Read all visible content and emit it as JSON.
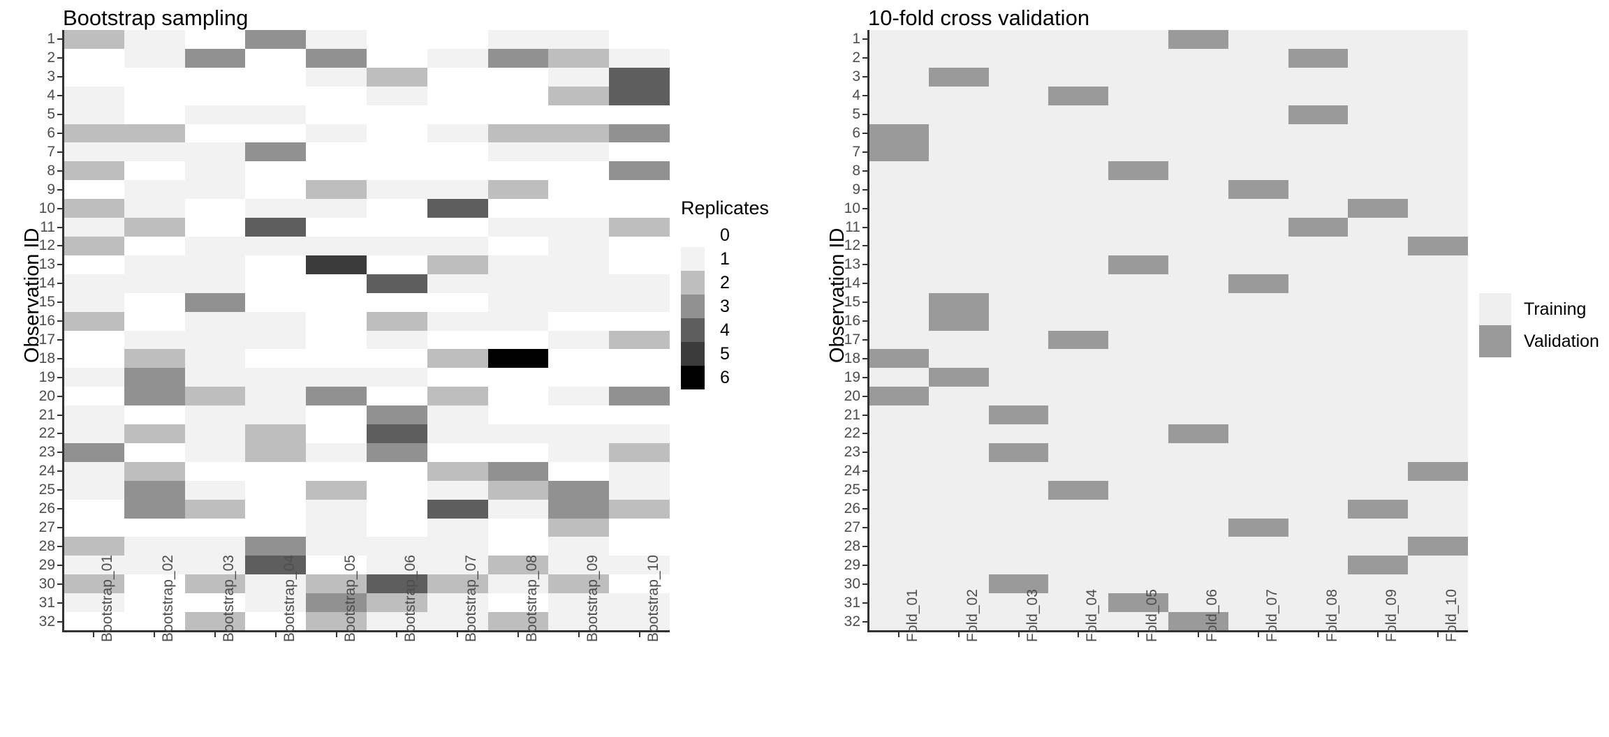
{
  "left_panel": {
    "title": "Bootstrap sampling",
    "y_axis_title": "Observation ID",
    "legend_title": "Replicates"
  },
  "right_panel": {
    "title": "10-fold cross validation",
    "y_axis_title": "Observation ID"
  },
  "legend_replicates": {
    "title": "Replicates",
    "entries": [
      {
        "label": "0",
        "color": "#FFFFFF"
      },
      {
        "label": "1",
        "color": "#F2F2F2"
      },
      {
        "label": "2",
        "color": "#BEBEBE"
      },
      {
        "label": "3",
        "color": "#919191"
      },
      {
        "label": "4",
        "color": "#5E5E5E"
      },
      {
        "label": "5",
        "color": "#3B3B3B"
      },
      {
        "label": "6",
        "color": "#000000"
      }
    ]
  },
  "legend_cv": {
    "entries": [
      {
        "label": "Training",
        "color": "#EFEFEF"
      },
      {
        "label": "Validation",
        "color": "#9A9A9A"
      }
    ]
  },
  "chart_data": [
    {
      "type": "heatmap",
      "title": "Bootstrap sampling",
      "xlabel": "",
      "ylabel": "Observation ID",
      "legend_title": "Replicates",
      "legend_position": "right",
      "grid": false,
      "value_range": [
        0,
        6
      ],
      "color_scale": [
        "#FFFFFF",
        "#F2F2F2",
        "#BEBEBE",
        "#919191",
        "#5E5E5E",
        "#3B3B3B",
        "#000000"
      ],
      "x": [
        "Bootstrap_01",
        "Bootstrap_02",
        "Bootstrap_03",
        "Bootstrap_04",
        "Bootstrap_05",
        "Bootstrap_06",
        "Bootstrap_07",
        "Bootstrap_08",
        "Bootstrap_09",
        "Bootstrap_10"
      ],
      "y": [
        "1",
        "2",
        "3",
        "4",
        "5",
        "6",
        "7",
        "8",
        "9",
        "10",
        "11",
        "12",
        "13",
        "14",
        "15",
        "16",
        "17",
        "18",
        "19",
        "20",
        "21",
        "22",
        "23",
        "24",
        "25",
        "26",
        "27",
        "28",
        "29",
        "30",
        "31",
        "32"
      ],
      "values": [
        [
          2,
          1,
          0,
          3,
          1,
          0,
          0,
          1,
          1,
          0
        ],
        [
          0,
          1,
          3,
          0,
          3,
          0,
          1,
          3,
          2,
          1
        ],
        [
          0,
          0,
          0,
          0,
          1,
          2,
          0,
          0,
          1,
          4
        ],
        [
          1,
          0,
          0,
          0,
          0,
          1,
          0,
          0,
          2,
          4
        ],
        [
          1,
          0,
          1,
          1,
          0,
          0,
          0,
          0,
          0,
          0
        ],
        [
          2,
          2,
          0,
          0,
          1,
          0,
          1,
          2,
          2,
          3
        ],
        [
          1,
          1,
          1,
          3,
          0,
          0,
          0,
          1,
          1,
          0
        ],
        [
          2,
          0,
          1,
          0,
          0,
          0,
          0,
          0,
          0,
          3
        ],
        [
          0,
          1,
          1,
          0,
          2,
          1,
          1,
          2,
          0,
          0
        ],
        [
          2,
          1,
          0,
          1,
          1,
          0,
          4,
          0,
          0,
          0
        ],
        [
          1,
          2,
          0,
          4,
          0,
          0,
          0,
          1,
          1,
          2
        ],
        [
          2,
          0,
          1,
          1,
          1,
          1,
          1,
          0,
          1,
          0
        ],
        [
          0,
          1,
          1,
          0,
          5,
          0,
          2,
          1,
          1,
          0
        ],
        [
          1,
          1,
          1,
          0,
          0,
          4,
          1,
          1,
          1,
          1
        ],
        [
          1,
          0,
          3,
          0,
          0,
          0,
          0,
          1,
          1,
          1
        ],
        [
          2,
          0,
          1,
          1,
          0,
          2,
          1,
          1,
          0,
          0
        ],
        [
          0,
          1,
          1,
          1,
          0,
          1,
          0,
          0,
          1,
          2
        ],
        [
          0,
          2,
          1,
          0,
          0,
          0,
          2,
          6,
          0,
          0
        ],
        [
          1,
          3,
          1,
          1,
          1,
          1,
          0,
          0,
          0,
          0
        ],
        [
          0,
          3,
          2,
          1,
          3,
          0,
          2,
          0,
          1,
          3
        ],
        [
          1,
          0,
          1,
          1,
          0,
          3,
          1,
          0,
          0,
          0
        ],
        [
          1,
          2,
          1,
          2,
          0,
          4,
          1,
          1,
          1,
          1
        ],
        [
          3,
          0,
          1,
          2,
          1,
          3,
          0,
          0,
          1,
          2
        ],
        [
          1,
          2,
          0,
          0,
          0,
          0,
          2,
          3,
          0,
          1
        ],
        [
          1,
          3,
          1,
          0,
          2,
          0,
          1,
          2,
          3,
          1
        ],
        [
          0,
          3,
          2,
          0,
          1,
          0,
          4,
          1,
          3,
          2
        ],
        [
          0,
          0,
          0,
          0,
          1,
          0,
          1,
          0,
          2,
          0
        ],
        [
          2,
          1,
          1,
          3,
          1,
          1,
          1,
          0,
          1,
          0
        ],
        [
          1,
          1,
          1,
          4,
          0,
          1,
          1,
          2,
          1,
          1
        ],
        [
          2,
          0,
          2,
          1,
          2,
          4,
          2,
          1,
          2,
          0
        ],
        [
          1,
          0,
          0,
          1,
          3,
          2,
          1,
          0,
          1,
          1
        ],
        [
          0,
          0,
          2,
          0,
          2,
          1,
          1,
          2,
          1,
          1
        ]
      ]
    },
    {
      "type": "heatmap",
      "title": "10-fold cross validation",
      "xlabel": "",
      "ylabel": "Observation ID",
      "legend_position": "right",
      "grid": false,
      "categories_legend": [
        "Training",
        "Validation"
      ],
      "color_scale": [
        "#EFEFEF",
        "#9A9A9A"
      ],
      "x": [
        "Fold_01",
        "Fold_02",
        "Fold_03",
        "Fold_04",
        "Fold_05",
        "Fold_06",
        "Fold_07",
        "Fold_08",
        "Fold_09",
        "Fold_10"
      ],
      "y": [
        "1",
        "2",
        "3",
        "4",
        "5",
        "6",
        "7",
        "8",
        "9",
        "10",
        "11",
        "12",
        "13",
        "14",
        "15",
        "16",
        "17",
        "18",
        "19",
        "20",
        "21",
        "22",
        "23",
        "24",
        "25",
        "26",
        "27",
        "28",
        "29",
        "30",
        "31",
        "32"
      ],
      "validation_fold_per_observation": [
        6,
        8,
        2,
        4,
        8,
        1,
        1,
        5,
        7,
        9,
        8,
        10,
        5,
        7,
        2,
        2,
        4,
        1,
        2,
        1,
        3,
        6,
        3,
        10,
        4,
        9,
        7,
        10,
        9,
        3,
        5,
        6
      ],
      "values": [
        [
          0,
          0,
          0,
          0,
          0,
          1,
          0,
          0,
          0,
          0
        ],
        [
          0,
          0,
          0,
          0,
          0,
          0,
          0,
          1,
          0,
          0
        ],
        [
          0,
          1,
          0,
          0,
          0,
          0,
          0,
          0,
          0,
          0
        ],
        [
          0,
          0,
          0,
          1,
          0,
          0,
          0,
          0,
          0,
          0
        ],
        [
          0,
          0,
          0,
          0,
          0,
          0,
          0,
          1,
          0,
          0
        ],
        [
          1,
          0,
          0,
          0,
          0,
          0,
          0,
          0,
          0,
          0
        ],
        [
          1,
          0,
          0,
          0,
          0,
          0,
          0,
          0,
          0,
          0
        ],
        [
          0,
          0,
          0,
          0,
          1,
          0,
          0,
          0,
          0,
          0
        ],
        [
          0,
          0,
          0,
          0,
          0,
          0,
          1,
          0,
          0,
          0
        ],
        [
          0,
          0,
          0,
          0,
          0,
          0,
          0,
          0,
          1,
          0
        ],
        [
          0,
          0,
          0,
          0,
          0,
          0,
          0,
          1,
          0,
          0
        ],
        [
          0,
          0,
          0,
          0,
          0,
          0,
          0,
          0,
          0,
          1
        ],
        [
          0,
          0,
          0,
          0,
          1,
          0,
          0,
          0,
          0,
          0
        ],
        [
          0,
          0,
          0,
          0,
          0,
          0,
          1,
          0,
          0,
          0
        ],
        [
          0,
          1,
          0,
          0,
          0,
          0,
          0,
          0,
          0,
          0
        ],
        [
          0,
          1,
          0,
          0,
          0,
          0,
          0,
          0,
          0,
          0
        ],
        [
          0,
          0,
          0,
          1,
          0,
          0,
          0,
          0,
          0,
          0
        ],
        [
          1,
          0,
          0,
          0,
          0,
          0,
          0,
          0,
          0,
          0
        ],
        [
          0,
          1,
          0,
          0,
          0,
          0,
          0,
          0,
          0,
          0
        ],
        [
          1,
          0,
          0,
          0,
          0,
          0,
          0,
          0,
          0,
          0
        ],
        [
          0,
          0,
          1,
          0,
          0,
          0,
          0,
          0,
          0,
          0
        ],
        [
          0,
          0,
          0,
          0,
          0,
          1,
          0,
          0,
          0,
          0
        ],
        [
          0,
          0,
          1,
          0,
          0,
          0,
          0,
          0,
          0,
          0
        ],
        [
          0,
          0,
          0,
          0,
          0,
          0,
          0,
          0,
          0,
          1
        ],
        [
          0,
          0,
          0,
          1,
          0,
          0,
          0,
          0,
          0,
          0
        ],
        [
          0,
          0,
          0,
          0,
          0,
          0,
          0,
          0,
          1,
          0
        ],
        [
          0,
          0,
          0,
          0,
          0,
          0,
          1,
          0,
          0,
          0
        ],
        [
          0,
          0,
          0,
          0,
          0,
          0,
          0,
          0,
          0,
          1
        ],
        [
          0,
          0,
          0,
          0,
          0,
          0,
          0,
          0,
          1,
          0
        ],
        [
          0,
          0,
          1,
          0,
          0,
          0,
          0,
          0,
          0,
          0
        ],
        [
          0,
          0,
          0,
          0,
          1,
          0,
          0,
          0,
          0,
          0
        ],
        [
          0,
          0,
          0,
          0,
          0,
          1,
          0,
          0,
          0,
          0
        ]
      ]
    }
  ]
}
